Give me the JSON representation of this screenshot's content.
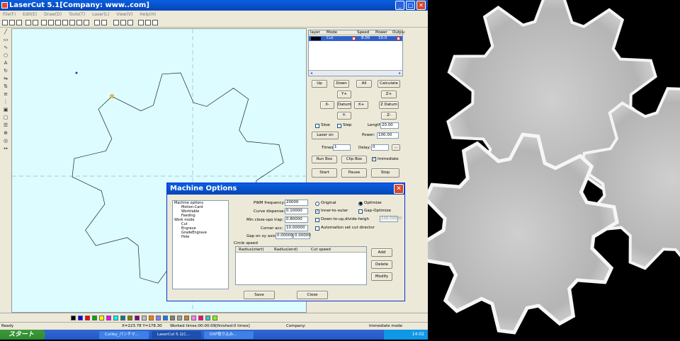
{
  "window": {
    "title": "LaserCut 5.1[Company: www..com]",
    "controls": [
      "_",
      "□",
      "✕"
    ]
  },
  "menu": [
    "File(F)",
    "Edit(E)",
    "Draw(D)",
    "Tools(T)",
    "Laser(L)",
    "View(V)",
    "Help(H)"
  ],
  "layer_table": {
    "headers": [
      "layer",
      "Mode",
      "Speed",
      "Power",
      "Outpu"
    ],
    "row": {
      "mode": "Cut",
      "speed": "8.00",
      "power": "10.0"
    }
  },
  "panel": {
    "up": "Up",
    "down": "Down",
    "all": "All",
    "calculate": "Calculate",
    "yplus": "Y+",
    "zplus": "Z+",
    "xminus": "X-",
    "datum": "Datum",
    "xplus": "X+",
    "zdatum": "Z Datum",
    "yminus": "Y-",
    "zminus": "Z-",
    "slow": "Slow",
    "step": "Step",
    "length_label": "Length:",
    "length_value": "20.00",
    "laser_on": "Laser on",
    "power_label": "Power:",
    "power_value": "100.00",
    "times_label": "Times:",
    "times_value": "1",
    "delay_label": "Delay:",
    "delay_value": "0",
    "ellipsis": "...",
    "run_box": "Run Box",
    "clip_box": "Clip Box",
    "immediate": "Immediate",
    "start": "Start",
    "pause": "Pause",
    "stop": "Stop"
  },
  "dialog": {
    "title": "Machine Options",
    "tree": [
      "Machine options",
      "Motion-Card",
      "Worktable",
      "Feeding",
      "Work mode",
      "Cut",
      "Engrave",
      "GradeEngrave",
      "Hole"
    ],
    "fields": [
      {
        "label": "PWM frequency:",
        "value": "20000"
      },
      {
        "label": "Curve dispense:",
        "value": "0.10000"
      },
      {
        "label": "Min close-spo trap:",
        "value": "0.80000"
      },
      {
        "label": "Corner acc:",
        "value": "10.00000"
      },
      {
        "label": "Gap on xy axis:",
        "value": "0.00000",
        "value2": "0.00000"
      }
    ],
    "options": [
      "Original",
      "Optimize",
      "Inner-to-outer",
      "Gap-Optimize",
      "Down-to-up,divide-heigh",
      "Automation set cut director"
    ],
    "gap_value": "100.00000",
    "circle_speed": "Circle speed",
    "grid_headers": [
      "Radius(start)",
      "Radius(end)",
      "Cut speed"
    ],
    "add": "Add",
    "delete": "Delete",
    "modify": "Modify",
    "save": "Save",
    "close": "Close"
  },
  "status": {
    "ready": "Ready",
    "coords": "X=223.78 Y=178.30",
    "worked": "Worked times:00:00:09[finished:0 times]",
    "company": "Company:",
    "mode": "Immediate mode"
  },
  "taskbar": {
    "start": "スタート",
    "items": [
      "Cutley_パンチマ...",
      "LaserCut 5.1[C...",
      "DXF取り込み..."
    ],
    "clock": "14:02"
  },
  "colors": {
    "canvas": "#dcfcff",
    "titlebar": "#0a5fe0",
    "swatches": [
      "#000000",
      "#0000ff",
      "#ff0000",
      "#00aa00",
      "#ffff00",
      "#ff00ff",
      "#00ffff",
      "#008080",
      "#808000",
      "#800080",
      "#c0c0c0",
      "#ff8000",
      "#8080ff",
      "#0080ff",
      "#808080",
      "#a0a0a0",
      "#c08040",
      "#ff80ff",
      "#ff0080",
      "#40c0c0",
      "#80ff00"
    ]
  }
}
